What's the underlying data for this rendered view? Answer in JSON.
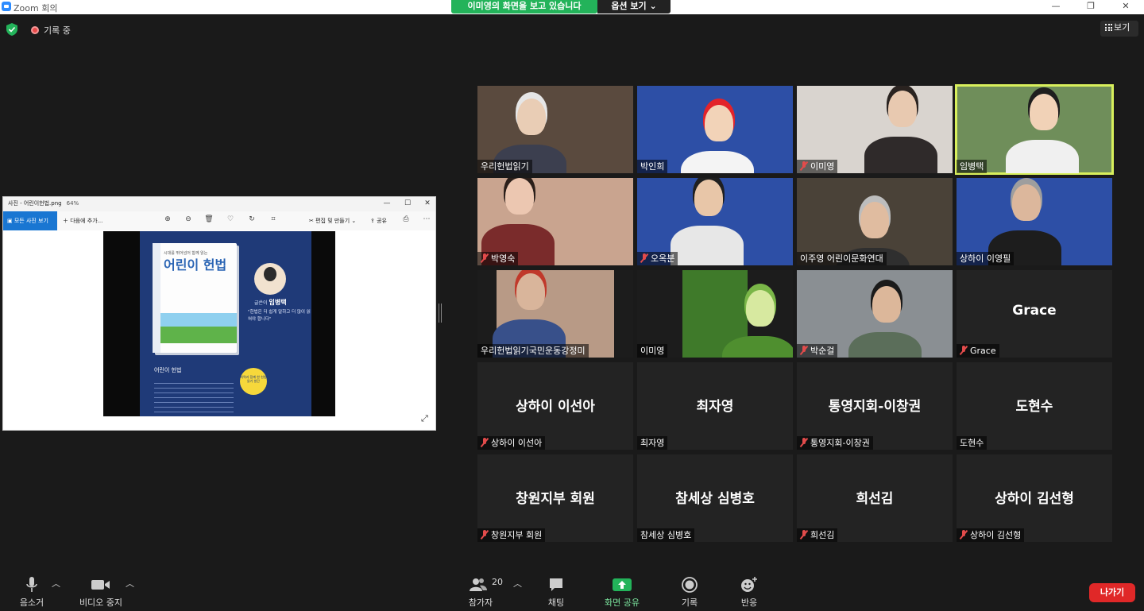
{
  "window": {
    "title": "Zoom 회의",
    "share_banner": "이미영의 화면을 보고 있습니다",
    "view_options": "옵션 보기 ⌄",
    "minimize": "—",
    "maximize": "❐",
    "close": "✕"
  },
  "meeting": {
    "recording_label": "기록 중",
    "view_label": "보기"
  },
  "shared_screen": {
    "window_title": "사진 - 어린이헌법.png",
    "zoom_level": "64%",
    "all_photos": "모든 사진 보기",
    "add_to": "다음에 추가...",
    "edit_create": "편집 및 만들기",
    "share": "공유",
    "book": {
      "subtitle": "시대를 뛰어넘어 함께 읽는",
      "title": "어린이 헌법",
      "author_prefix": "글쓴이",
      "author": "임병택",
      "quote": "\"헌법은 더 쉽게 말하고 더 많이 읽혀야 합니다\"",
      "small_title": "어린이 헌법",
      "badge": "지역과 함께 한 헌법 읽기 발간"
    }
  },
  "participants": [
    {
      "name": "우리헌법읽기",
      "big": "",
      "muted": false,
      "video": true,
      "active": false,
      "bg": "#5a4a3e"
    },
    {
      "name": "박인희",
      "big": "",
      "muted": false,
      "video": true,
      "active": false,
      "bg": "#2d4fa6"
    },
    {
      "name": "이미영",
      "big": "",
      "muted": true,
      "video": true,
      "active": false,
      "bg": "#d9d4cf"
    },
    {
      "name": "임병택",
      "big": "",
      "muted": false,
      "video": true,
      "active": true,
      "bg": "#6f8e5a"
    },
    {
      "name": "박영숙",
      "big": "",
      "muted": true,
      "video": true,
      "active": false,
      "bg": "#c9a48f"
    },
    {
      "name": "오옥분",
      "big": "",
      "muted": true,
      "video": true,
      "active": false,
      "bg": "#2d4fa6"
    },
    {
      "name": "이주영 어린이문화연대",
      "big": "",
      "muted": false,
      "video": true,
      "active": false,
      "bg": "#4a4238"
    },
    {
      "name": "상하이 이영필",
      "big": "",
      "muted": false,
      "video": true,
      "active": false,
      "bg": "#2d4fa6"
    },
    {
      "name": "우리헌법읽기국민운동강정미",
      "big": "",
      "muted": false,
      "video": true,
      "active": false,
      "bg": "#1c1c1c"
    },
    {
      "name": "이미영",
      "big": "",
      "muted": false,
      "video": true,
      "active": false,
      "bg": "#1c1c1c"
    },
    {
      "name": "박순걸",
      "big": "",
      "muted": true,
      "video": true,
      "active": false,
      "bg": "#8a8f93"
    },
    {
      "name": "Grace",
      "big": "Grace",
      "muted": true,
      "video": false,
      "active": false,
      "bg": "#232323"
    },
    {
      "name": "상하이 이선아",
      "big": "상하이 이선아",
      "muted": true,
      "video": false,
      "active": false,
      "bg": "#232323"
    },
    {
      "name": "최자영",
      "big": "최자영",
      "muted": false,
      "video": false,
      "active": false,
      "bg": "#232323"
    },
    {
      "name": "통영지회-이창권",
      "big": "통영지회-이창권",
      "muted": true,
      "video": false,
      "active": false,
      "bg": "#232323"
    },
    {
      "name": "도현수",
      "big": "도현수",
      "muted": false,
      "video": false,
      "active": false,
      "bg": "#232323"
    },
    {
      "name": "창원지부 회원",
      "big": "창원지부 회원",
      "muted": true,
      "video": false,
      "active": false,
      "bg": "#232323"
    },
    {
      "name": "참세상 심병호",
      "big": "참세상 심병호",
      "muted": false,
      "video": false,
      "active": false,
      "bg": "#232323"
    },
    {
      "name": "희선김",
      "big": "희선김",
      "muted": true,
      "video": false,
      "active": false,
      "bg": "#232323"
    },
    {
      "name": "상하이 김선형",
      "big": "상하이 김선형",
      "muted": true,
      "video": false,
      "active": false,
      "bg": "#232323"
    }
  ],
  "toolbar": {
    "mute": "음소거",
    "stop_video": "비디오 중지",
    "participants": "참가자",
    "participant_count": "20",
    "chat": "채팅",
    "share_screen": "화면 공유",
    "record": "기록",
    "reactions": "반응",
    "leave": "나가기"
  },
  "colors": {
    "share_green": "#23b35a",
    "active_speaker": "#d8ef5c",
    "leave_red": "#e02828",
    "muted_red": "#e24b4b"
  }
}
